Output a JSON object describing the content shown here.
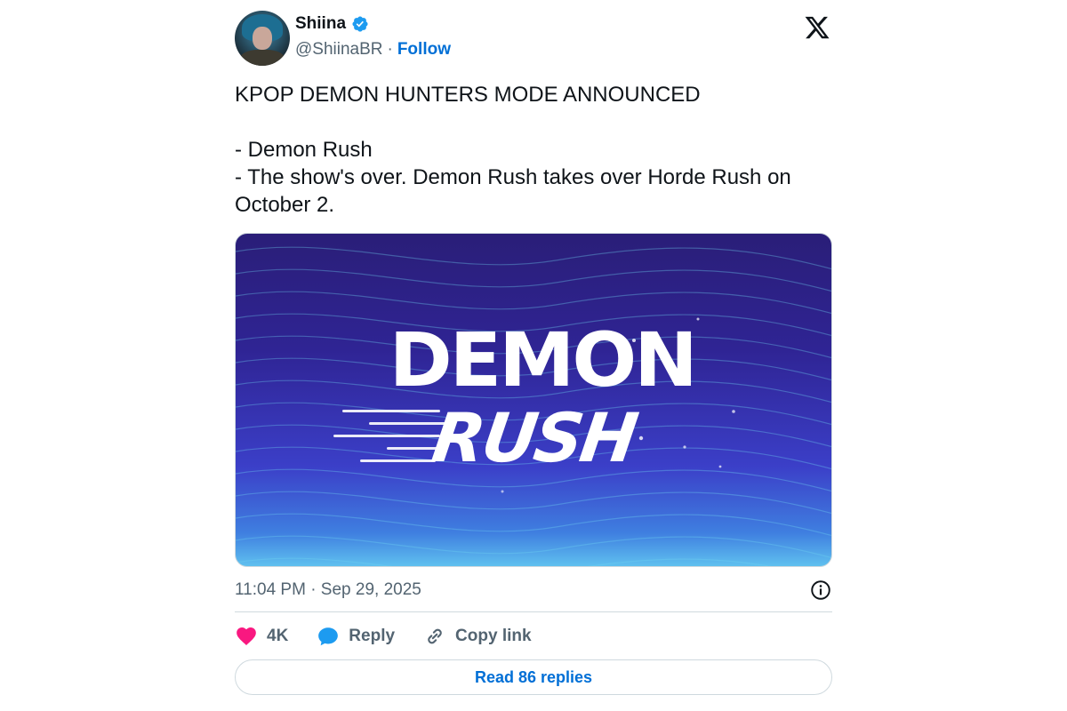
{
  "author": {
    "name": "Shiina",
    "handle": "@ShiinaBR",
    "separator": "·",
    "follow_label": "Follow",
    "verified_icon": "verified-badge-icon",
    "avatar_icon": "avatar"
  },
  "platform_icon": "x-logo-icon",
  "tweet": {
    "line1": "KPOP DEMON HUNTERS MODE ANNOUNCED",
    "line2": "- Demon Rush",
    "line3": "- The show's over. Demon Rush takes over Horde Rush on October 2."
  },
  "media": {
    "title_top": "DEMON",
    "title_bottom": "RUSH"
  },
  "timestamp": "11:04 PM · Sep 29, 2025",
  "actions": {
    "likes": "4K",
    "reply_label": "Reply",
    "copy_link_label": "Copy link"
  },
  "read_replies_label": "Read 86 replies",
  "colors": {
    "link": "#006fd6",
    "heart": "#f91880",
    "reply_bubble": "#1d9bf0",
    "muted_text": "#536471",
    "border": "#cfd9de"
  }
}
